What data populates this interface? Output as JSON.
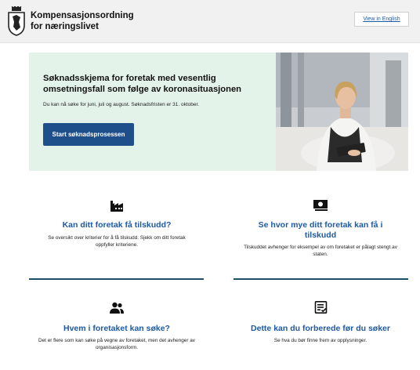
{
  "header": {
    "brand_line1": "Kompensasjonsordning",
    "brand_line2": "for næringslivet",
    "lang_button": "View in English"
  },
  "hero": {
    "title": "Søknadsskjema for foretak med vesentlig omsetningsfall som følge av koronasituasjonen",
    "text": "Du kan nå søke for juni, juli og august. Søknadsfristen er 31. oktober.",
    "button": "Start søknadsprosessen"
  },
  "cards": [
    {
      "icon": "factory-icon",
      "title": "Kan ditt foretak få tilskudd?",
      "text": "Se oversikt over kriterier for å få tilskudd. Sjekk om ditt foretak oppfyller kriteriene."
    },
    {
      "icon": "money-icon",
      "title": "Se hvor mye ditt foretak kan få i tilskudd",
      "text": "Tilskuddet avhenger for eksempel av om foretaket er pålagt stengt av staten."
    },
    {
      "icon": "people-icon",
      "title": "Hvem i foretaket kan søke?",
      "text": "Det er flere som kan søke på vegne av foretaket, men det avhenger av organisasjonsform."
    },
    {
      "icon": "checklist-icon",
      "title": "Dette kan du forberede før du søker",
      "text": "Se hva du bør finne frem av opplysninger."
    }
  ],
  "colors": {
    "accent": "#1d5aa6",
    "button": "#1f4f8b",
    "hero_bg": "#e4f3ea",
    "divider": "#1e4d67"
  }
}
